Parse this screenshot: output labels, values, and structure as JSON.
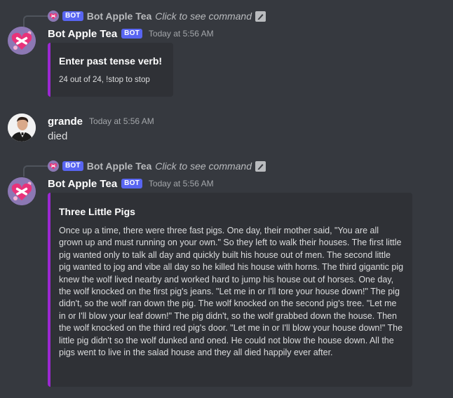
{
  "messages": [
    {
      "reply": {
        "author": "Bot Apple Tea",
        "badge": "BOT",
        "command_text": "Click to see command"
      },
      "author": "Bot Apple Tea",
      "badge": "BOT",
      "timestamp": "Today at 5:56 AM",
      "embed": {
        "title": "Enter past tense verb!",
        "footer": "24 out of 24, !stop to stop",
        "accent_color": "#9b28d2"
      }
    },
    {
      "author": "grande",
      "timestamp": "Today at 5:56 AM",
      "text": "died"
    },
    {
      "reply": {
        "author": "Bot Apple Tea",
        "badge": "BOT",
        "command_text": "Click to see command"
      },
      "author": "Bot Apple Tea",
      "badge": "BOT",
      "timestamp": "Today at 5:56 AM",
      "embed": {
        "title": "Three Little Pigs",
        "description": "Once up a time, there were three fast pigs. One day, their mother said, \"You are all grown up and must running on your own.\" So they left to walk their houses. The first little pig wanted only to talk all day and quickly built his house out of men. The second little pig wanted to jog and vibe all day so he killed his house with horns. The third gigantic pig knew the wolf lived nearby and worked hard to jump his house out of horses. One day, the wolf knocked on the first pig's jeans. \"Let me in or I'll tore your house down!\" The pig didn't, so the wolf ran down the pig. The wolf knocked on the second pig's tree. \"Let me in or I'll blow your leaf down!\" The pig didn't, so the wolf grabbed down the house. Then the wolf knocked on the third red pig's door. \"Let me in or I'll blow your house down!\" The little pig didn't so the wolf dunked and oned. He could not blow the house down. All the pigs went to live in the salad house and they all died happily ever after.",
        "accent_color": "#9b28d2"
      }
    }
  ],
  "colors": {
    "background": "#36393f",
    "embed_background": "#2f3136",
    "bot_badge": "#5865f2",
    "embed_accent": "#9b28d2"
  },
  "icons": {
    "bot_avatar": "pink-heart-with-crossbones-avatar",
    "user_avatar": "man-portrait-avatar",
    "command_icon": "slash-command-icon"
  }
}
